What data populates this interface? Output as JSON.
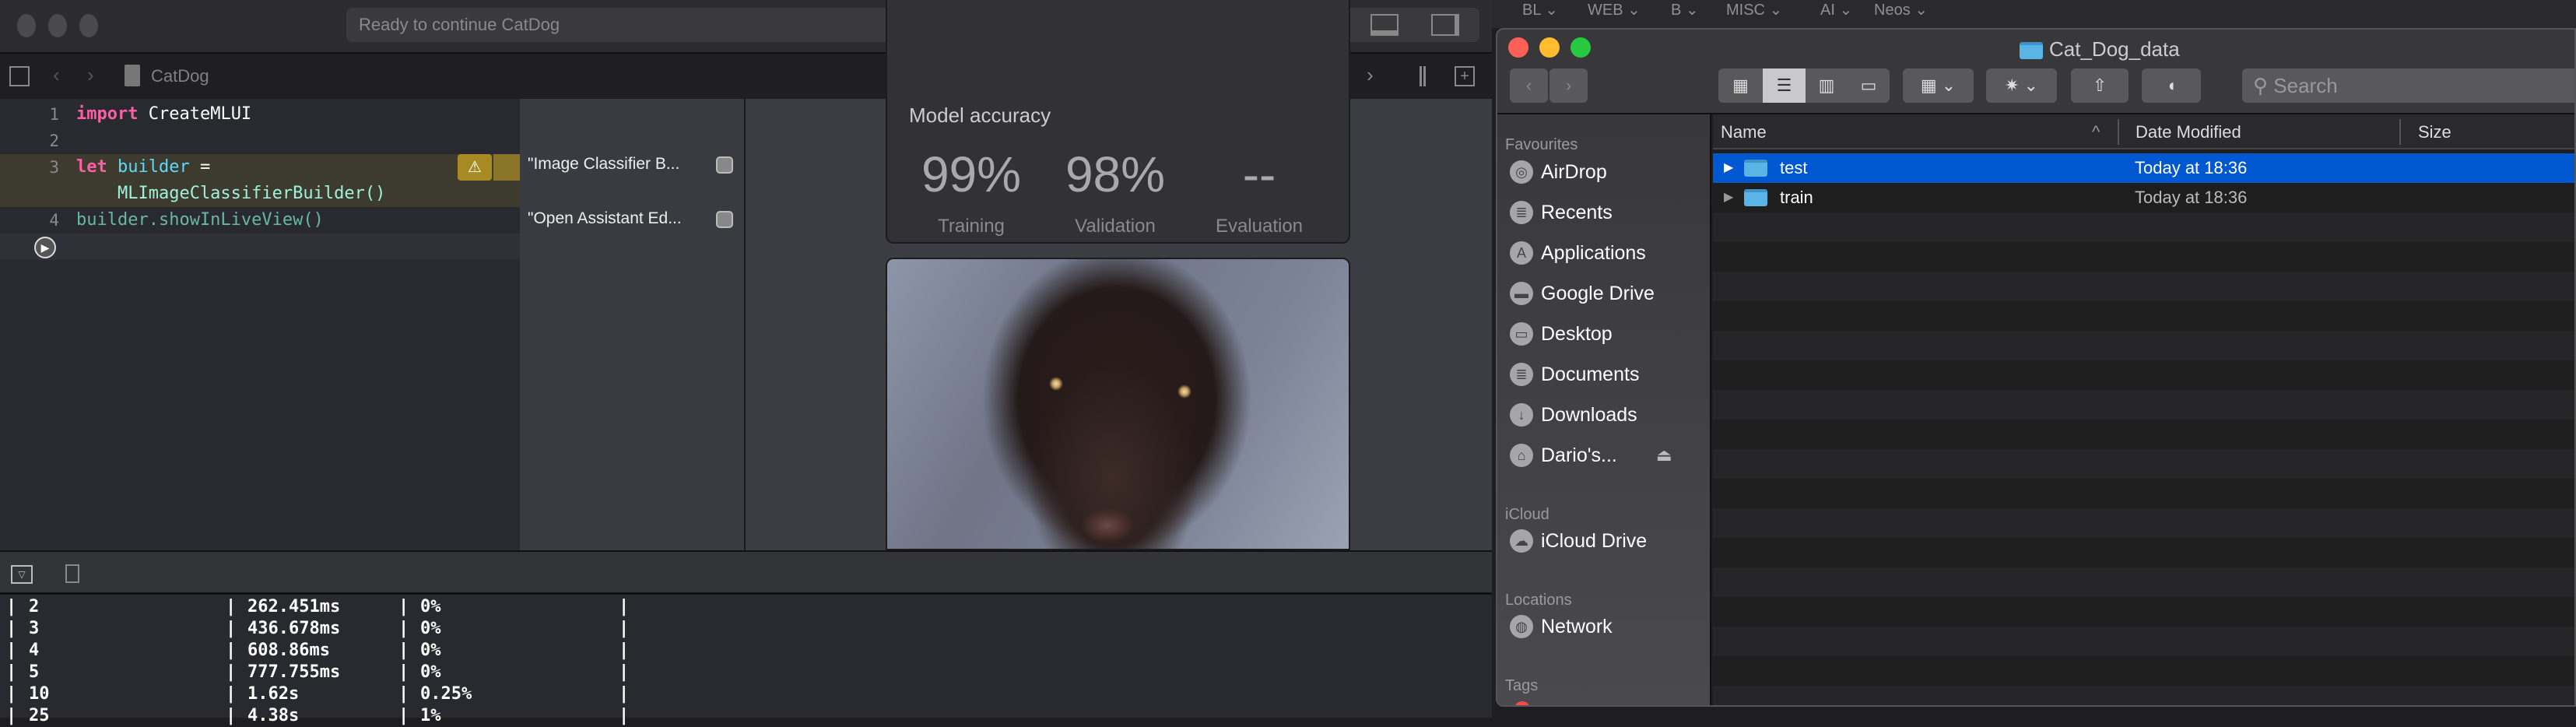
{
  "xcode": {
    "status": "Ready to continue CatDog",
    "warning_count": "1",
    "breadcrumb": "CatDog",
    "code": [
      {
        "n": "1",
        "parts": [
          {
            "t": "import",
            "c": "kw"
          },
          {
            "t": " CreateMLUI",
            "c": ""
          }
        ]
      },
      {
        "n": "2",
        "parts": []
      },
      {
        "n": "3",
        "parts": [
          {
            "t": "let",
            "c": "kw"
          },
          {
            "t": " builder",
            "c": "var"
          },
          {
            "t": " =",
            "c": ""
          }
        ]
      },
      {
        "n": "",
        "parts": [
          {
            "t": "    MLImageClassifierBuilder()",
            "c": "fn"
          }
        ]
      },
      {
        "n": "4",
        "parts": [
          {
            "t": "builder.showInLiveView()",
            "c": "fn2"
          }
        ]
      }
    ],
    "results": [
      "\"Image Classifier B...",
      "\"Open Assistant Ed..."
    ],
    "live_view": {
      "title": "Model accuracy",
      "metrics": [
        {
          "value": "99%",
          "label": "Training"
        },
        {
          "value": "98%",
          "label": "Validation"
        },
        {
          "value": "--",
          "label": "Evaluation"
        }
      ]
    },
    "console_rows": [
      [
        "2",
        "262.451ms",
        "0%"
      ],
      [
        "3",
        "436.678ms",
        "0%"
      ],
      [
        "4",
        "608.86ms",
        "0%"
      ],
      [
        "5",
        "777.755ms",
        "0%"
      ],
      [
        "10",
        "1.62s",
        "0.25%"
      ],
      [
        "25",
        "4.38s",
        "1%"
      ]
    ]
  },
  "bookmarks": [
    "BL",
    "WEB",
    "B",
    "MISC",
    "AI",
    "Neos"
  ],
  "finder": {
    "title": "Cat_Dog_data",
    "search_placeholder": "Search",
    "columns": {
      "name": "Name",
      "date": "Date Modified",
      "size": "Size"
    },
    "files": [
      {
        "name": "test",
        "date": "Today at 18:36",
        "selected": true
      },
      {
        "name": "train",
        "date": "Today at 18:36",
        "selected": false
      }
    ],
    "sidebar": {
      "favourites_label": "Favourites",
      "favourites": [
        {
          "label": "AirDrop",
          "icon": "airdrop-icon"
        },
        {
          "label": "Recents",
          "icon": "recents-icon"
        },
        {
          "label": "Applications",
          "icon": "applications-icon"
        },
        {
          "label": "Google Drive",
          "icon": "folder-icon"
        },
        {
          "label": "Desktop",
          "icon": "desktop-icon"
        },
        {
          "label": "Documents",
          "icon": "documents-icon"
        },
        {
          "label": "Downloads",
          "icon": "downloads-icon"
        },
        {
          "label": "Dario's...",
          "icon": "drive-icon"
        }
      ],
      "icloud_label": "iCloud",
      "icloud": [
        {
          "label": "iCloud Drive",
          "icon": "cloud-icon"
        }
      ],
      "locations_label": "Locations",
      "locations": [
        {
          "label": "Network",
          "icon": "network-icon"
        }
      ],
      "tags_label": "Tags"
    }
  },
  "colors": {
    "selection": "#0058d0",
    "keyword": "#fc5fa3",
    "warning": "#f5c000"
  }
}
